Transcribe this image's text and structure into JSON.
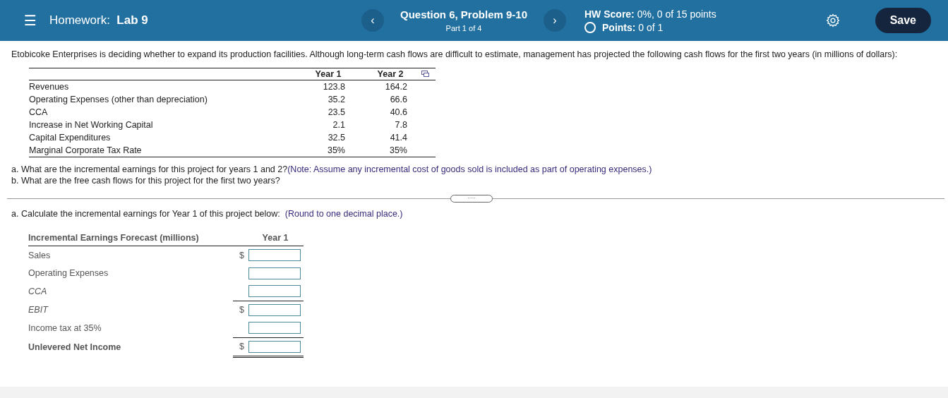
{
  "header": {
    "menu_glyph": "☰",
    "title_prefix": "Homework:",
    "title": "Lab 9",
    "prev_glyph": "‹",
    "question": "Question 6, Problem 9-10",
    "part": "Part 1 of 4",
    "next_glyph": "›",
    "score_label": "HW Score:",
    "score": "0%, 0 of 15 points",
    "points_label": "Points:",
    "points": "0 of 1",
    "save": "Save"
  },
  "intro": "Etobicoke Enterprises is deciding whether to expand its production facilities. Although long-term cash flows are difficult to estimate, management has projected the following cash flows for the first two years (in millions of dollars):",
  "data_table": {
    "columns": [
      "Year 1",
      "Year 2"
    ],
    "rows": [
      {
        "label": "Revenues",
        "values": [
          "123.8",
          "164.2"
        ]
      },
      {
        "label": "Operating Expenses (other than depreciation)",
        "values": [
          "35.2",
          "66.6"
        ]
      },
      {
        "label": "CCA",
        "values": [
          "23.5",
          "40.6"
        ]
      },
      {
        "label": "Increase in Net Working Capital",
        "values": [
          "2.1",
          "7.8"
        ]
      },
      {
        "label": "Capital Expenditures",
        "values": [
          "32.5",
          "41.4"
        ]
      },
      {
        "label": "Marginal Corporate Tax Rate",
        "values": [
          "35%",
          "35%"
        ]
      }
    ]
  },
  "questions": [
    {
      "text": "a. What are the incremental earnings for this project for years 1 and 2?",
      "note": "(Note: Assume any incremental cost of goods sold is included as part of operating expenses.)"
    },
    {
      "text": "b. What are the free cash flows for this project for the first two years?"
    }
  ],
  "divider_glyph": ".....",
  "task": {
    "text": "a. Calculate the incremental earnings for Year 1 of this project below:",
    "note": "(Round to one decimal place.)"
  },
  "answer_table": {
    "title": "Incremental Earnings Forecast (millions)",
    "column": "Year 1",
    "rows": [
      {
        "label": "Sales",
        "kind": "plain",
        "currency": "$"
      },
      {
        "label": "Operating Expenses",
        "kind": "plain",
        "rule_above": false
      },
      {
        "label": "CCA",
        "kind": "italic",
        "rule_above": false
      },
      {
        "label": "EBIT",
        "kind": "italic",
        "currency": "$",
        "rule_above": true
      },
      {
        "label": "Income tax at 35%",
        "kind": "plain",
        "rule_above": false
      },
      {
        "label": "Unlevered Net Income",
        "kind": "total",
        "currency": "$",
        "rule_above": true
      }
    ]
  }
}
